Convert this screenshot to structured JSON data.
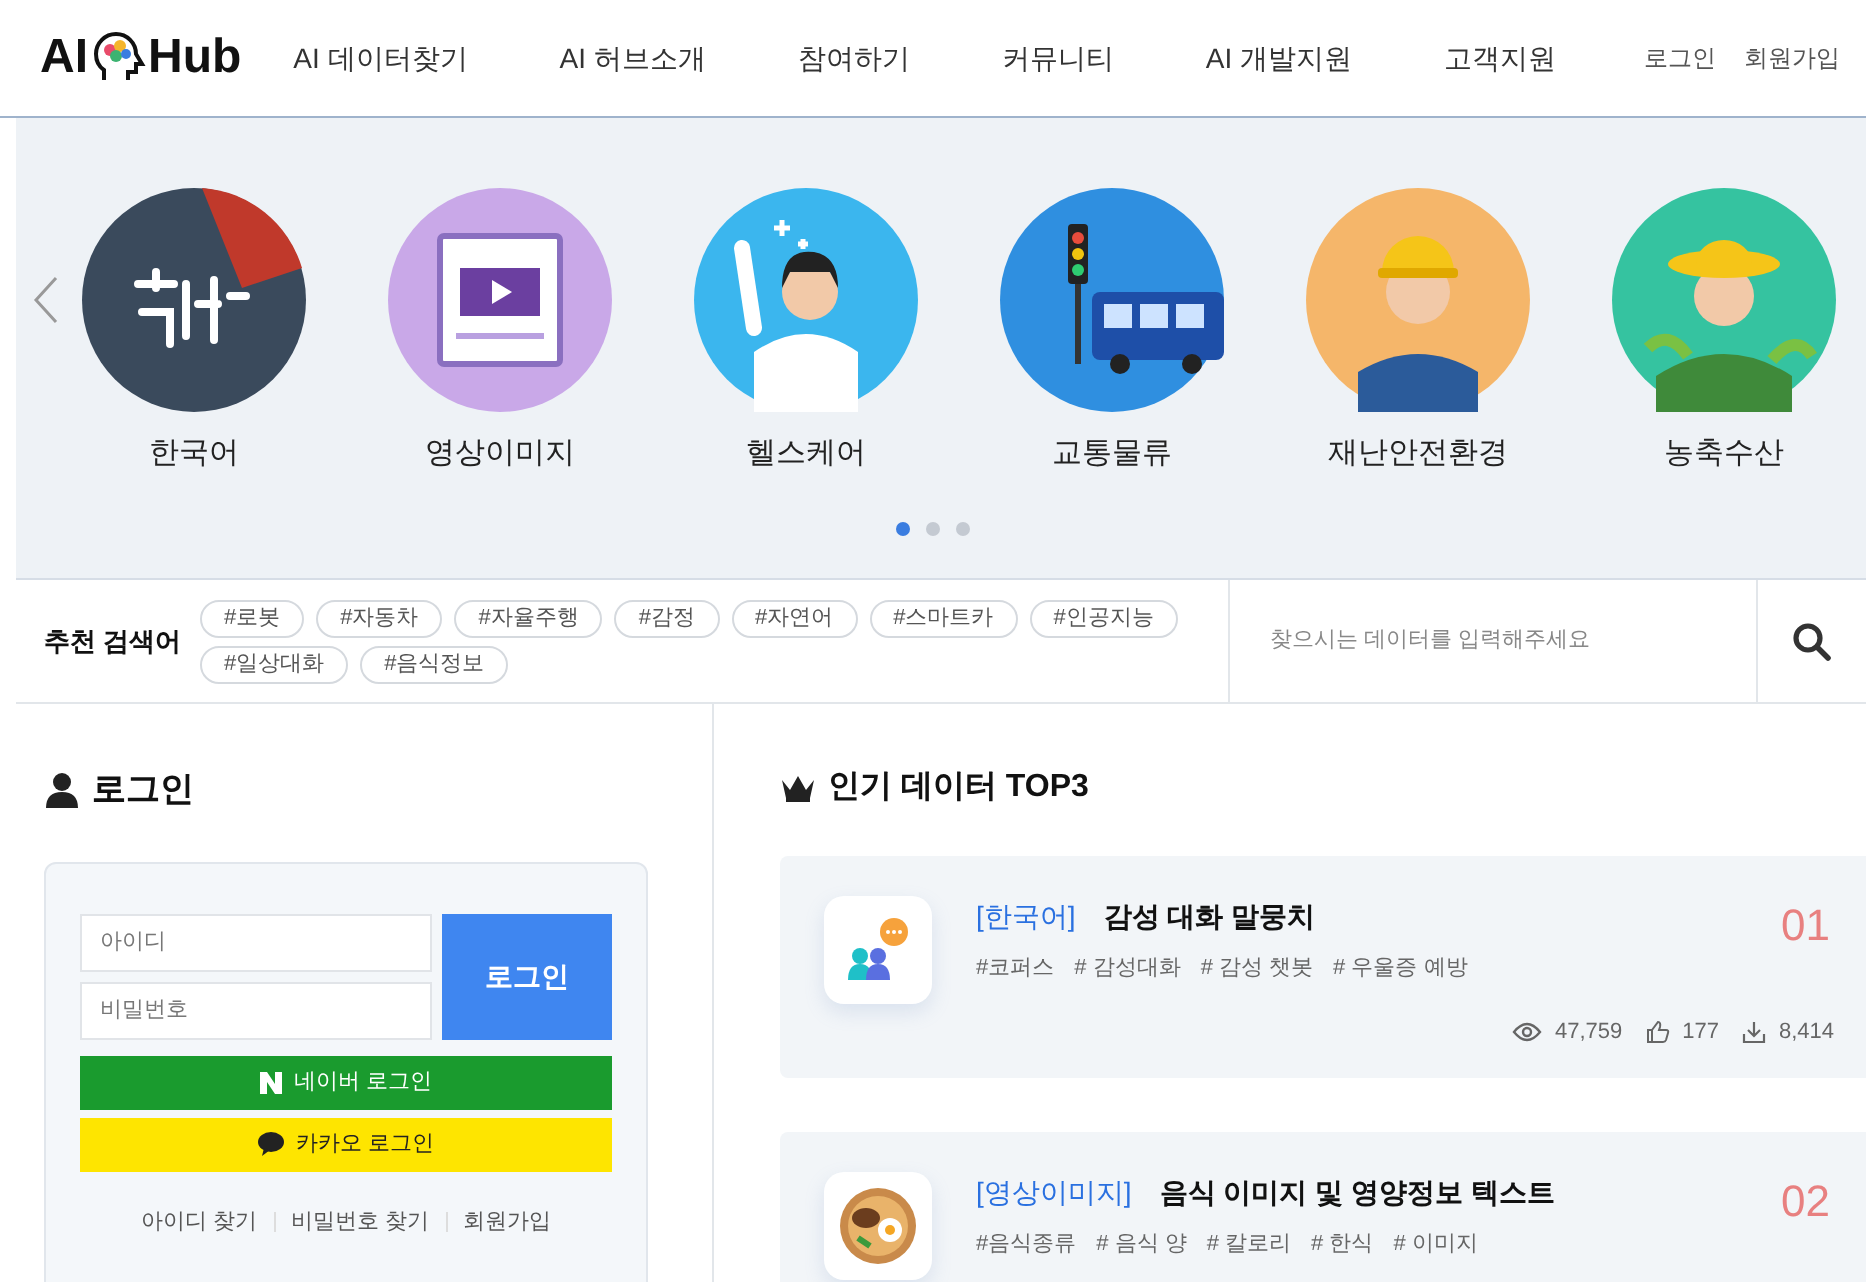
{
  "header": {
    "logo_left": "AI",
    "logo_right": "Hub",
    "nav": [
      "AI 데이터찾기",
      "AI 허브소개",
      "참여하기",
      "커뮤니티",
      "AI 개발지원",
      "고객지원"
    ],
    "utility_links": [
      "로그인",
      "회원가입"
    ]
  },
  "carousel": {
    "items": [
      {
        "label": "한국어",
        "kind": "hangul",
        "color": "#3a4a5c"
      },
      {
        "label": "영상이미지",
        "kind": "video",
        "color": "#c9a8e8"
      },
      {
        "label": "헬스케어",
        "kind": "doctor",
        "color": "#3bb6ee"
      },
      {
        "label": "교통물류",
        "kind": "bus",
        "color": "#2f8fe0"
      },
      {
        "label": "재난안전환경",
        "kind": "worker",
        "color": "#f5b66a"
      },
      {
        "label": "농축수산",
        "kind": "farmer",
        "color": "#35c3a0"
      }
    ],
    "dots": [
      {
        "selected": true
      },
      {
        "selected": false
      },
      {
        "selected": false
      }
    ]
  },
  "recommended": {
    "label": "추천 검색어",
    "tags": [
      "#로봇",
      "#자동차",
      "#자율주행",
      "#감정",
      "#자연어",
      "#스마트카",
      "#인공지능",
      "#일상대화",
      "#음식정보"
    ],
    "search": {
      "placeholder": "찾으시는 데이터를 입력해주세요"
    }
  },
  "login": {
    "title": "로그인",
    "id_placeholder": "아이디",
    "password_placeholder": "비밀번호",
    "login_button": "로그인",
    "naver_button": "네이버 로그인",
    "kakao_button": "카카오 로그인",
    "links": [
      "아이디 찾기",
      "비밀번호 찾기",
      "회원가입"
    ]
  },
  "top3": {
    "title": "인기 데이터 TOP3",
    "items": [
      {
        "kind": "people",
        "category": "[한국어]",
        "title": "감성 대화 말뭉치",
        "tags": [
          "#코퍼스",
          "# 감성대화",
          "# 감성 챗봇",
          "# 우울증 예방"
        ],
        "rank": "01",
        "views": "47,759",
        "likes": "177",
        "downloads": "8,414"
      },
      {
        "kind": "food",
        "category": "[영상이미지]",
        "title": "음식 이미지 및 영양정보 텍스트",
        "tags": [
          "#음식종류",
          "# 음식 양",
          "# 칼로리",
          "# 한식",
          "# 이미지"
        ],
        "rank": "02"
      }
    ]
  }
}
